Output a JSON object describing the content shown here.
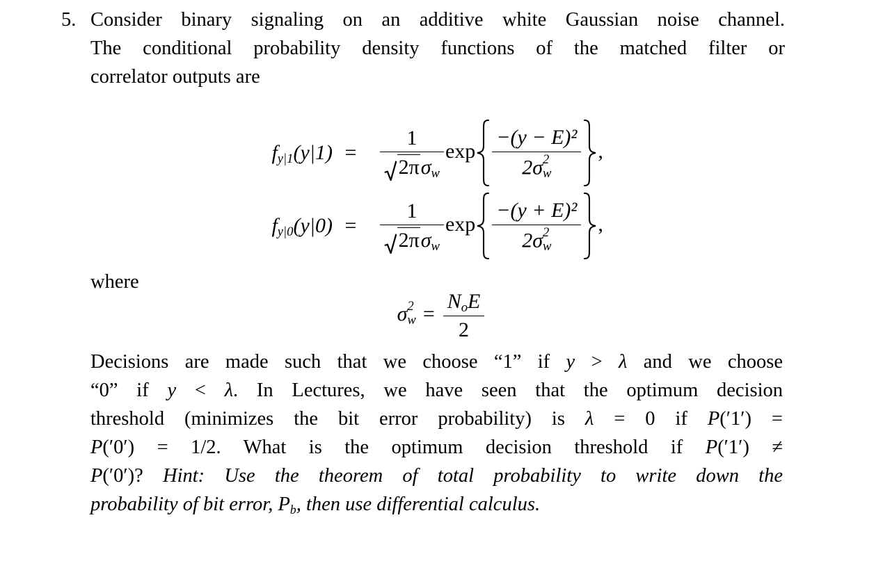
{
  "document": {
    "type": "textbook-problem",
    "background_color": "#ffffff",
    "text_color": "#000000",
    "problem_number": "5.",
    "intro_lines": [
      "Consider binary signaling on an additive white Gaussian noise channel.",
      "The conditional probability density functions of the matched filter or",
      "correlator outputs are"
    ],
    "equations": [
      {
        "id": "pdf-given-1",
        "lhs_f": "f",
        "lhs_sub": "y|1",
        "lhs_arg": "(y|1)",
        "relation": "=",
        "numerator": "1",
        "denominator_sqrt_radicand": "2π",
        "denominator_sigma": "σ",
        "denominator_sigma_sub": "w",
        "exp_label": "exp",
        "exp_numerator": "−(y − E)²",
        "exp_denominator": "2σ",
        "exp_denominator_sub": "w",
        "exp_denominator_sup": "2",
        "trailing_punctuation": ","
      },
      {
        "id": "pdf-given-0",
        "lhs_f": "f",
        "lhs_sub": "y|0",
        "lhs_arg": "(y|0)",
        "relation": "=",
        "numerator": "1",
        "denominator_sqrt_radicand": "2π",
        "denominator_sigma": "σ",
        "denominator_sigma_sub": "w",
        "exp_label": "exp",
        "exp_numerator": "−(y + E)²",
        "exp_denominator": "2σ",
        "exp_denominator_sub": "w",
        "exp_denominator_sup": "2",
        "trailing_punctuation": ","
      }
    ],
    "where_label": "where",
    "variance_equation": {
      "id": "noise-variance",
      "lhs_sigma": "σ",
      "lhs_sub": "w",
      "lhs_sup": "2",
      "relation": "=",
      "numerator_N": "N",
      "numerator_N_sub": "o",
      "numerator_E": "E",
      "denominator": "2"
    },
    "paragraph_lines": [
      {
        "id": "line-1",
        "segments": [
          {
            "text": "Decisions are made such that we choose “1” if ",
            "style": "roman"
          },
          {
            "text": "y",
            "style": "math"
          },
          {
            "text": " > ",
            "style": "roman"
          },
          {
            "text": "λ",
            "style": "math"
          },
          {
            "text": " and we choose",
            "style": "roman"
          }
        ]
      },
      {
        "id": "line-2",
        "segments": [
          {
            "text": "“0” if ",
            "style": "roman"
          },
          {
            "text": "y",
            "style": "math"
          },
          {
            "text": " < ",
            "style": "roman"
          },
          {
            "text": "λ",
            "style": "math"
          },
          {
            "text": ".  In Lectures, we have seen that the optimum decision",
            "style": "roman"
          }
        ]
      },
      {
        "id": "line-3",
        "segments": [
          {
            "text": "threshold (minimizes the bit error probability) is ",
            "style": "roman"
          },
          {
            "text": "λ",
            "style": "math"
          },
          {
            "text": " = 0 if ",
            "style": "roman"
          },
          {
            "text": "P",
            "style": "math"
          },
          {
            "text": "(′1′) =",
            "style": "roman"
          }
        ]
      },
      {
        "id": "line-4",
        "segments": [
          {
            "text": "P",
            "style": "math"
          },
          {
            "text": "(′0′) = 1/2.  What is the optimum decision threshold if ",
            "style": "roman"
          },
          {
            "text": "P",
            "style": "math"
          },
          {
            "text": "(′1′) ≠",
            "style": "roman"
          }
        ]
      },
      {
        "id": "line-5",
        "segments": [
          {
            "text": "P",
            "style": "math"
          },
          {
            "text": "(′0′)?  ",
            "style": "roman"
          },
          {
            "text": "Hint: Use the theorem of total probability to write down the",
            "style": "italic"
          }
        ]
      },
      {
        "id": "line-6",
        "segments": [
          {
            "text": "probability of bit error, ",
            "style": "italic"
          },
          {
            "text": "P",
            "style": "math-italic"
          },
          {
            "text": "b",
            "style": "italic-sub"
          },
          {
            "text": ", then use differential calculus.",
            "style": "italic"
          }
        ]
      }
    ],
    "paragraph_plain_text": "Decisions are made such that we choose “1” if y > λ and we choose “0” if y < λ. In Lectures, we have seen that the optimum decision threshold (minimizes the bit error probability) is λ = 0 if P('1') = P('0') = 1/2. What is the optimum decision threshold if P('1') ≠ P('0')? Hint: Use the theorem of total probability to write down the probability of bit error, Pb, then use differential calculus."
  }
}
